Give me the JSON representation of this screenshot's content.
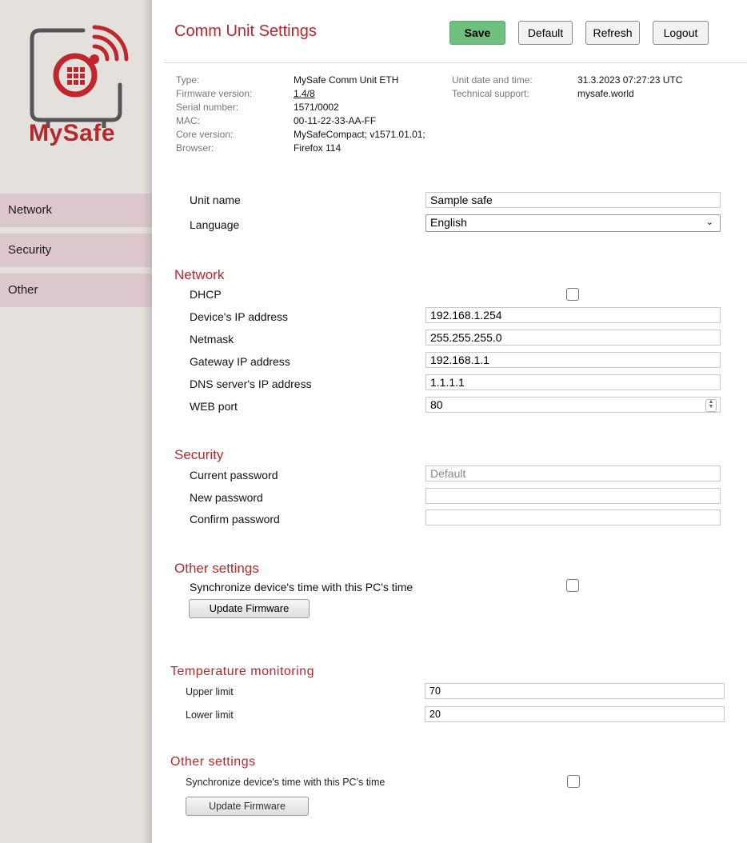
{
  "brand": {
    "name": "MySafe",
    "accent": "#b5282e"
  },
  "sidebar": {
    "items": [
      {
        "label": "Network"
      },
      {
        "label": "Security"
      },
      {
        "label": "Other"
      }
    ]
  },
  "header": {
    "title": "Comm Unit Settings",
    "buttons": {
      "save": "Save",
      "default": "Default",
      "refresh": "Refresh",
      "logout": "Logout"
    }
  },
  "info": {
    "left": [
      {
        "label": "Type:",
        "value": "MySafe Comm Unit ETH"
      },
      {
        "label": "Firmware version:",
        "value": "1.4/8"
      },
      {
        "label": "Serial number:",
        "value": "1571/0002"
      },
      {
        "label": "MAC:",
        "value": "00-11-22-33-AA-FF"
      },
      {
        "label": "Core version:",
        "value": "MySafeCompact; v1571.01.01;"
      },
      {
        "label": "Browser:",
        "value": "Firefox 114"
      }
    ],
    "right": [
      {
        "label": "Unit date and time:",
        "value": "31.3.2023 07:27:23 UTC"
      },
      {
        "label": "Technical support:",
        "value": "mysafe.world"
      }
    ]
  },
  "general": {
    "unit_name": {
      "label": "Unit name",
      "value": "Sample safe"
    },
    "language": {
      "label": "Language",
      "value": "English"
    }
  },
  "network": {
    "heading": "Network",
    "dhcp": {
      "label": "DHCP",
      "checked": false
    },
    "ip": {
      "label": "Device's IP address",
      "value": "192.168.1.254"
    },
    "netmask": {
      "label": "Netmask",
      "value": "255.255.255.0"
    },
    "gateway": {
      "label": "Gateway IP address",
      "value": "192.168.1.1"
    },
    "dns": {
      "label": "DNS server's IP address",
      "value": "1.1.1.1"
    },
    "port": {
      "label": "WEB port",
      "value": "80"
    }
  },
  "security": {
    "heading": "Security",
    "current": {
      "label": "Current password",
      "placeholder": "Default"
    },
    "new": {
      "label": "New password",
      "value": ""
    },
    "confirm": {
      "label": "Confirm password",
      "value": ""
    }
  },
  "other": {
    "heading": "Other settings",
    "sync": {
      "label": "Synchronize device's time with this PC's time",
      "checked": false
    },
    "firmware_button": "Update Firmware"
  },
  "temperature": {
    "heading": "Temperature monitoring",
    "upper": {
      "label": "Upper limit",
      "value": "70"
    },
    "lower": {
      "label": "Lower limit",
      "value": "20"
    }
  },
  "other2": {
    "heading": "Other settings",
    "sync": {
      "label": "Synchronize device's time with this PC's time",
      "checked": false
    },
    "firmware_button": "Update Firmware"
  }
}
